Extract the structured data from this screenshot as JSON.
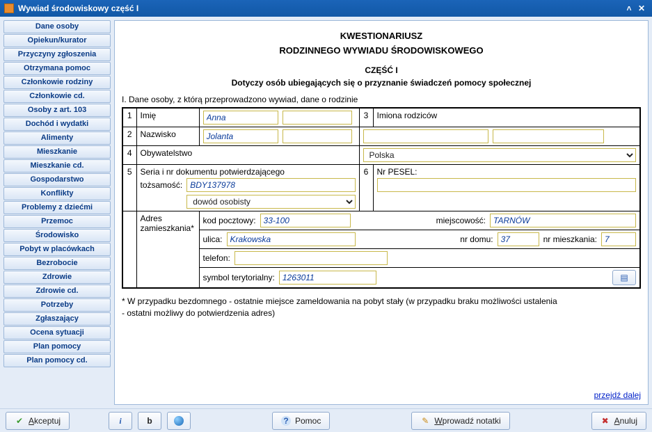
{
  "window": {
    "title": "Wywiad środowiskowy część I"
  },
  "sidebar": {
    "items": [
      "Dane osoby",
      "Opiekun/kurator",
      "Przyczyny zgłoszenia",
      "Otrzymana pomoc",
      "Członkowie rodziny",
      "Członkowie cd.",
      "Osoby z art. 103",
      "Dochód i wydatki",
      "Alimenty",
      "Mieszkanie",
      "Mieszkanie cd.",
      "Gospodarstwo",
      "Konflikty",
      "Problemy z dziećmi",
      "Przemoc",
      "Środowisko",
      "Pobyt w placówkach",
      "Bezrobocie",
      "Zdrowie",
      "Zdrowie cd.",
      "Potrzeby",
      "Zgłaszający",
      "Ocena sytuacji",
      "Plan pomocy",
      "Plan pomocy cd."
    ]
  },
  "header": {
    "line1": "KWESTIONARIUSZ",
    "line2": "RODZINNEGO WYWIADU ŚRODOWISKOWEGO",
    "part": "CZĘŚĆ I",
    "subtitle": "Dotyczy osób ubiegających się o przyznanie świadczeń pomocy społecznej"
  },
  "section": {
    "title": "I. Dane osoby, z którą przeprowadzono wywiad, dane o rodzinie"
  },
  "labels": {
    "imie_num": "1",
    "imie": "Imię",
    "nazwisko_num": "2",
    "nazwisko": "Nazwisko",
    "rodzice_num": "3",
    "rodzice": "Imiona rodziców",
    "obyw_num": "4",
    "obyw": "Obywatelstwo",
    "dok_num": "5",
    "dok_line1": "Seria i nr dokumentu potwierdzającego",
    "dok_line2": "tożsamość:",
    "pesel_num": "6",
    "pesel": "Nr PESEL:",
    "adres1": "Adres",
    "adres2": "zamieszkania*",
    "kod": "kod pocztowy:",
    "miejsc": "miejscowość:",
    "ulica": "ulica:",
    "nrdomu": "nr domu:",
    "nrmieszk": "nr mieszkania:",
    "telefon": "telefon:",
    "symbol": "symbol terytorialny:"
  },
  "values": {
    "imie1": "Anna",
    "imie2": "",
    "nazwisko1": "Jolanta",
    "nazwisko2": "",
    "rodzic1": "",
    "rodzic2": "",
    "obywatelstwo": "Polska",
    "dok_nr": "BDY137978",
    "dok_typ": "dowód osobisty",
    "pesel": "",
    "kod": "33-100",
    "miejsc": "TARNÓW",
    "ulica": "Krakowska",
    "nrdomu": "37",
    "nrmieszk": "7",
    "telefon": "",
    "symbol": "1263011"
  },
  "note": {
    "l1": "* W przypadku bezdomnego - ostatnie miejsce zameldowania na pobyt stały (w przypadku braku możliwości ustalenia",
    "l2": "  - ostatni możliwy do potwierdzenia adres)"
  },
  "link": {
    "next": "przejdź dalej"
  },
  "footer": {
    "accept_pre": "A",
    "accept_rest": "kceptuj",
    "help": "Pomoc",
    "notes_pre": "W",
    "notes_rest": "prowadź notatki",
    "cancel_pre": "A",
    "cancel_rest": "nuluj"
  }
}
